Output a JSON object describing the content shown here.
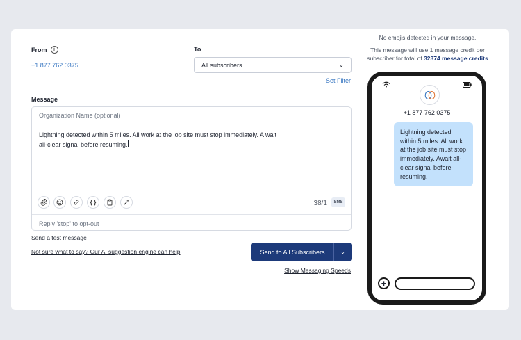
{
  "form": {
    "from_label": "From",
    "from_value": "+1 877 762 0375",
    "to_label": "To",
    "to_selected": "All subscribers",
    "set_filter": "Set Filter",
    "message_label": "Message",
    "org_placeholder": "Organization Name (optional)",
    "message_text": "Lightning detected within 5 miles. All work at the job site must stop immediately. A wait all-clear signal before resuming.",
    "char_count": "38/1",
    "sms_badge": "SMS",
    "opt_out": "Reply 'stop' to opt-out",
    "send_test": "Send a test message",
    "ai_suggestion": "Not sure what to say? Our AI suggestion engine can help",
    "send_button": "Send to All Subscribers",
    "show_speeds": "Show Messaging Speeds"
  },
  "tools": [
    "paperclip-icon",
    "emoji-icon",
    "link-icon",
    "braces-icon",
    "clipboard-icon",
    "magic-wand-icon"
  ],
  "preview": {
    "emoji_note": "No emojis detected in your message.",
    "credit_note_prefix": "This message will use 1 message credit per subscriber for total of",
    "credit_total": "32374 message credits",
    "phone_number": "+1 877 762 0375",
    "bubble_text": "Lightning detected within 5 miles. All work at the job site must stop immediately. Await all-clear signal before resuming."
  },
  "colors": {
    "accent": "#1d3a7a",
    "link": "#3a78c2",
    "bubble": "#c3e1fc"
  }
}
